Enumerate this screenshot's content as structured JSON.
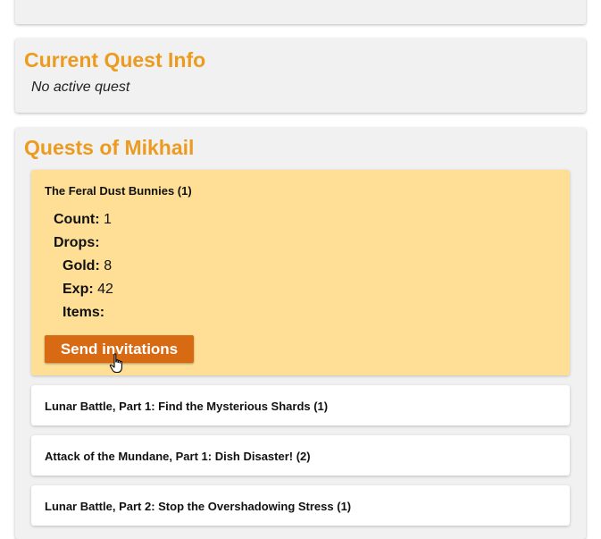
{
  "current_quest": {
    "title": "Current Quest Info",
    "status": "No active quest"
  },
  "quests_panel": {
    "title": "Quests of Mikhail",
    "quests": [
      {
        "name": "The Feral Dust Bunnies (1)",
        "count_label": "Count:",
        "count": "1",
        "drops_label": "Drops:",
        "gold_label": "Gold:",
        "gold": "8",
        "exp_label": "Exp:",
        "exp": "42",
        "items_label": "Items:",
        "button_label": "Send invitations"
      },
      {
        "name": "Lunar Battle, Part 1: Find the Mysterious Shards (1)"
      },
      {
        "name": "Attack of the Mundane, Part 1: Dish Disaster! (2)"
      },
      {
        "name": "Lunar Battle, Part 2: Stop the Overshadowing Stress (1)"
      }
    ]
  },
  "colors": {
    "accent": "#ec9b1f",
    "active_card": "#fedf95",
    "button": "#d76a12"
  },
  "icons": {
    "cursor": "hand-pointer-icon"
  }
}
